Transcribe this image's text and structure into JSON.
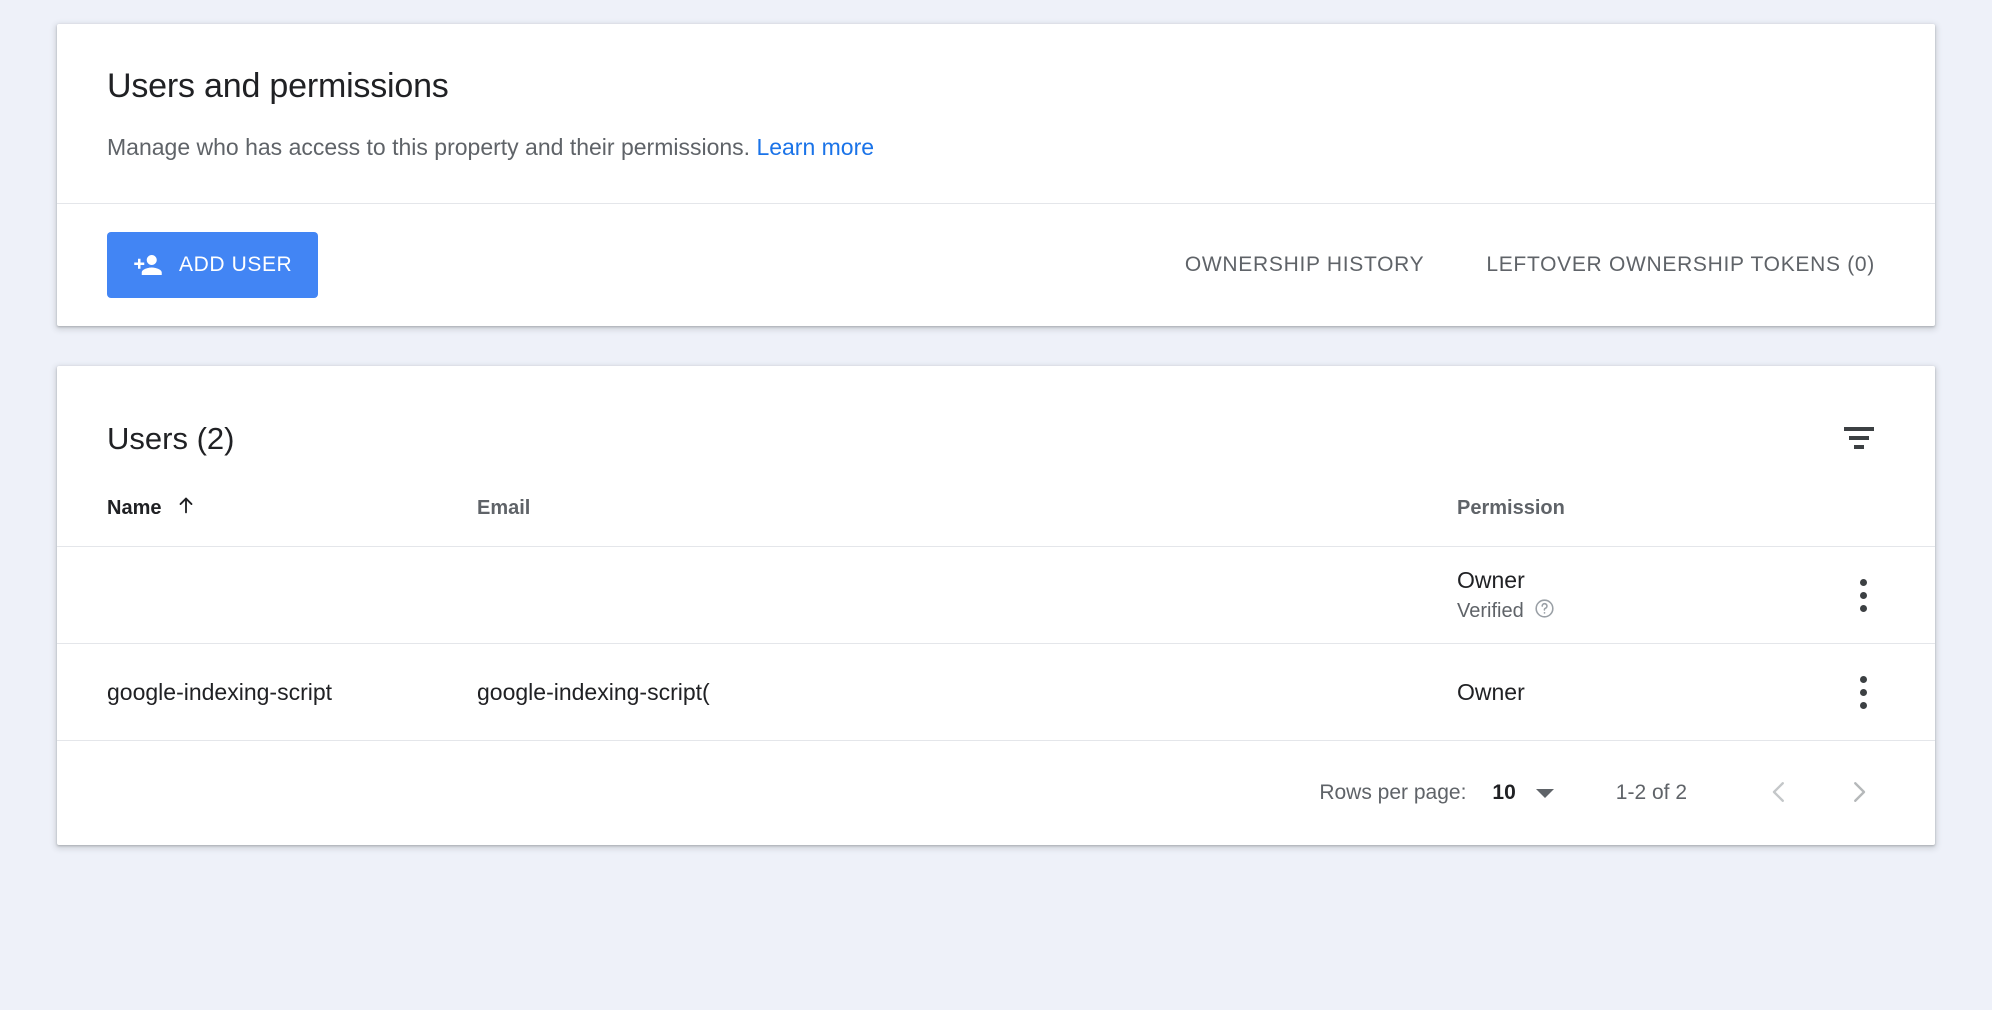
{
  "colors": {
    "background": "#eef1f9",
    "card": "#ffffff",
    "primary": "#4285f4",
    "link": "#1a73e8",
    "text_primary": "#202124",
    "text_secondary": "#5f6368",
    "divider": "#e4e6ea"
  },
  "header": {
    "title": "Users and permissions",
    "subtitle": "Manage who has access to this property and their permissions.",
    "learn_more_label": "Learn more"
  },
  "action_bar": {
    "add_user_label": "ADD USER",
    "add_user_icon": "person-add-icon",
    "tabs": [
      {
        "label": "OWNERSHIP HISTORY"
      },
      {
        "label": "LEFTOVER OWNERSHIP TOKENS (0)"
      }
    ]
  },
  "users_card": {
    "title": "Users (2)",
    "filter_icon": "filter-icon",
    "columns": {
      "name": "Name",
      "email": "Email",
      "permission": "Permission"
    },
    "sort": {
      "column": "Name",
      "direction_icon": "arrow-up-icon"
    },
    "rows": [
      {
        "name": "",
        "email": "",
        "permission": "Owner",
        "permission_note": "Verified",
        "permission_note_icon": "help-circle-icon",
        "menu_icon": "more-vert-icon"
      },
      {
        "name": "google-indexing-script",
        "email": "google-indexing-script(",
        "permission": "Owner",
        "permission_note": "",
        "permission_note_icon": "",
        "menu_icon": "more-vert-icon"
      }
    ],
    "pagination": {
      "rows_per_page_label": "Rows per page:",
      "rows_per_page_value": "10",
      "range_label": "1-2 of 2",
      "prev_icon": "chevron-left-icon",
      "next_icon": "chevron-right-icon"
    }
  }
}
